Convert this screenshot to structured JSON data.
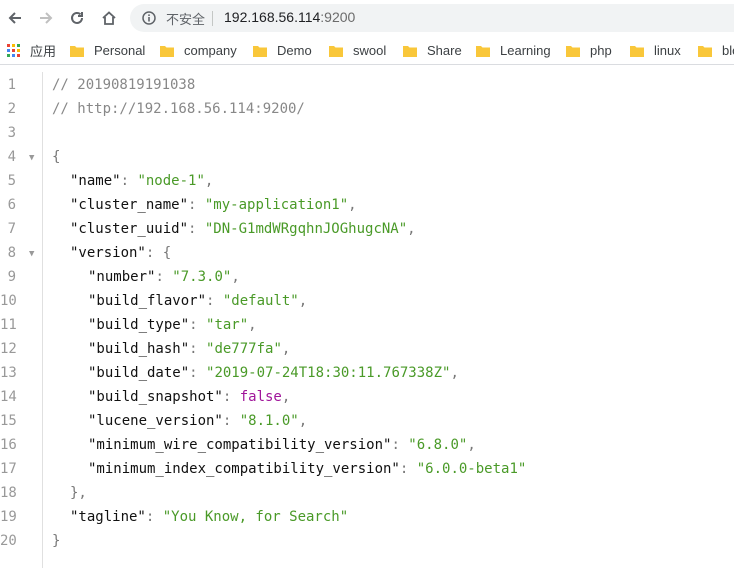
{
  "browser": {
    "security_label": "不安全",
    "url_host": "192.168.56.114",
    "url_port": ":9200",
    "bookmarks": [
      "应用",
      "Personal",
      "company",
      "Demo",
      "swool",
      "Share",
      "Learning",
      "php",
      "linux",
      "blo"
    ]
  },
  "json_view": {
    "line_numbers": [
      "1",
      "2",
      "3",
      "4",
      "5",
      "6",
      "7",
      "8",
      "9",
      "10",
      "11",
      "12",
      "13",
      "14",
      "15",
      "16",
      "17",
      "18",
      "19",
      "20"
    ],
    "comment_timestamp": "// 20190819191038",
    "comment_url": "// http://192.168.56.114:9200/",
    "open_brace": "{",
    "close_brace": "}",
    "keys": {
      "name": "\"name\"",
      "cluster_name": "\"cluster_name\"",
      "cluster_uuid": "\"cluster_uuid\"",
      "version": "\"version\"",
      "number": "\"number\"",
      "build_flavor": "\"build_flavor\"",
      "build_type": "\"build_type\"",
      "build_hash": "\"build_hash\"",
      "build_date": "\"build_date\"",
      "build_snapshot": "\"build_snapshot\"",
      "lucene_version": "\"lucene_version\"",
      "minimum_wire_compatibility_version": "\"minimum_wire_compatibility_version\"",
      "minimum_index_compatibility_version": "\"minimum_index_compatibility_version\"",
      "tagline": "\"tagline\""
    },
    "values": {
      "name": "\"node-1\"",
      "cluster_name": "\"my-application1\"",
      "cluster_uuid": "\"DN-G1mdWRgqhnJOGhugcNA\"",
      "number": "\"7.3.0\"",
      "build_flavor": "\"default\"",
      "build_type": "\"tar\"",
      "build_hash": "\"de777fa\"",
      "build_date": "\"2019-07-24T18:30:11.767338Z\"",
      "build_snapshot": "false",
      "lucene_version": "\"8.1.0\"",
      "minimum_wire_compatibility_version": "\"6.8.0\"",
      "minimum_index_compatibility_version": "\"6.0.0-beta1\"",
      "tagline": "\"You Know, for Search\""
    },
    "version_close": "},"
  }
}
